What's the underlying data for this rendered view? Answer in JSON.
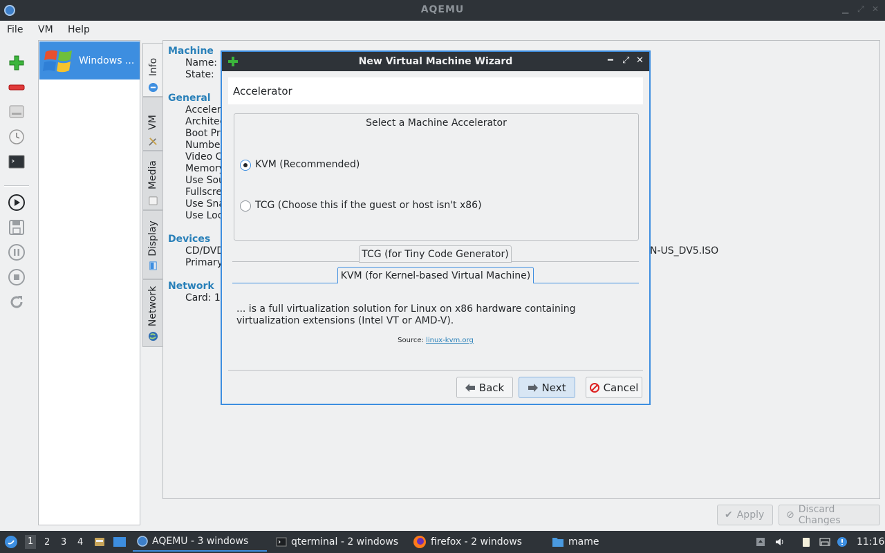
{
  "window": {
    "title": "AQEMU"
  },
  "menu": [
    "File",
    "VM",
    "Help"
  ],
  "vm_list": {
    "items": [
      {
        "name": "Windows ..."
      }
    ]
  },
  "vertical_tabs": [
    "Info",
    "VM",
    "Media",
    "Display",
    "Network"
  ],
  "details": {
    "sections": [
      {
        "title": "Machine",
        "fields": [
          "Name:",
          "State:"
        ]
      },
      {
        "title": "General",
        "fields": [
          "Accelera",
          "Architec",
          "Boot Pri",
          "Number",
          "Video C",
          "Memory",
          "Use Sou",
          "Fullscre",
          "Use Sna",
          "Use Loc"
        ]
      },
      {
        "title": "Devices",
        "fields": [
          "CD/DVD",
          "Primary"
        ]
      },
      {
        "title": "Network",
        "fields": [
          "Card: 1"
        ]
      }
    ],
    "iso_fragment": "N-US_DV5.ISO"
  },
  "bottom_buttons": {
    "apply": "Apply",
    "discard": "Discard Changes"
  },
  "dialog": {
    "title": "New Virtual Machine Wizard",
    "page_title": "Accelerator",
    "group_title": "Select a Machine Accelerator",
    "options": [
      {
        "label": "KVM (Recommended)",
        "selected": true
      },
      {
        "label": "TCG (Choose this if the guest or host isn't x86)",
        "selected": false
      }
    ],
    "tabs": [
      "TCG (for Tiny Code Generator)",
      "KVM (for Kernel-based Virtual Machine)"
    ],
    "active_tab": 1,
    "description": "... is a full virtualization solution for Linux on x86 hardware containing virtualization extensions (Intel VT or AMD-V).",
    "source_label": "Source:",
    "source_link": "linux-kvm.org",
    "buttons": {
      "back": "Back",
      "next": "Next",
      "cancel": "Cancel"
    }
  },
  "taskbar": {
    "workspaces": [
      "1",
      "2",
      "3",
      "4"
    ],
    "tasks": [
      {
        "label": "AQEMU - 3 windows"
      },
      {
        "label": "qterminal - 2 windows"
      },
      {
        "label": "firefox - 2 windows"
      },
      {
        "label": "mame"
      }
    ],
    "clock": "11:16"
  },
  "colors": {
    "accent": "#3d8ee0",
    "section": "#2980b9",
    "titlebar": "#2e3338"
  }
}
